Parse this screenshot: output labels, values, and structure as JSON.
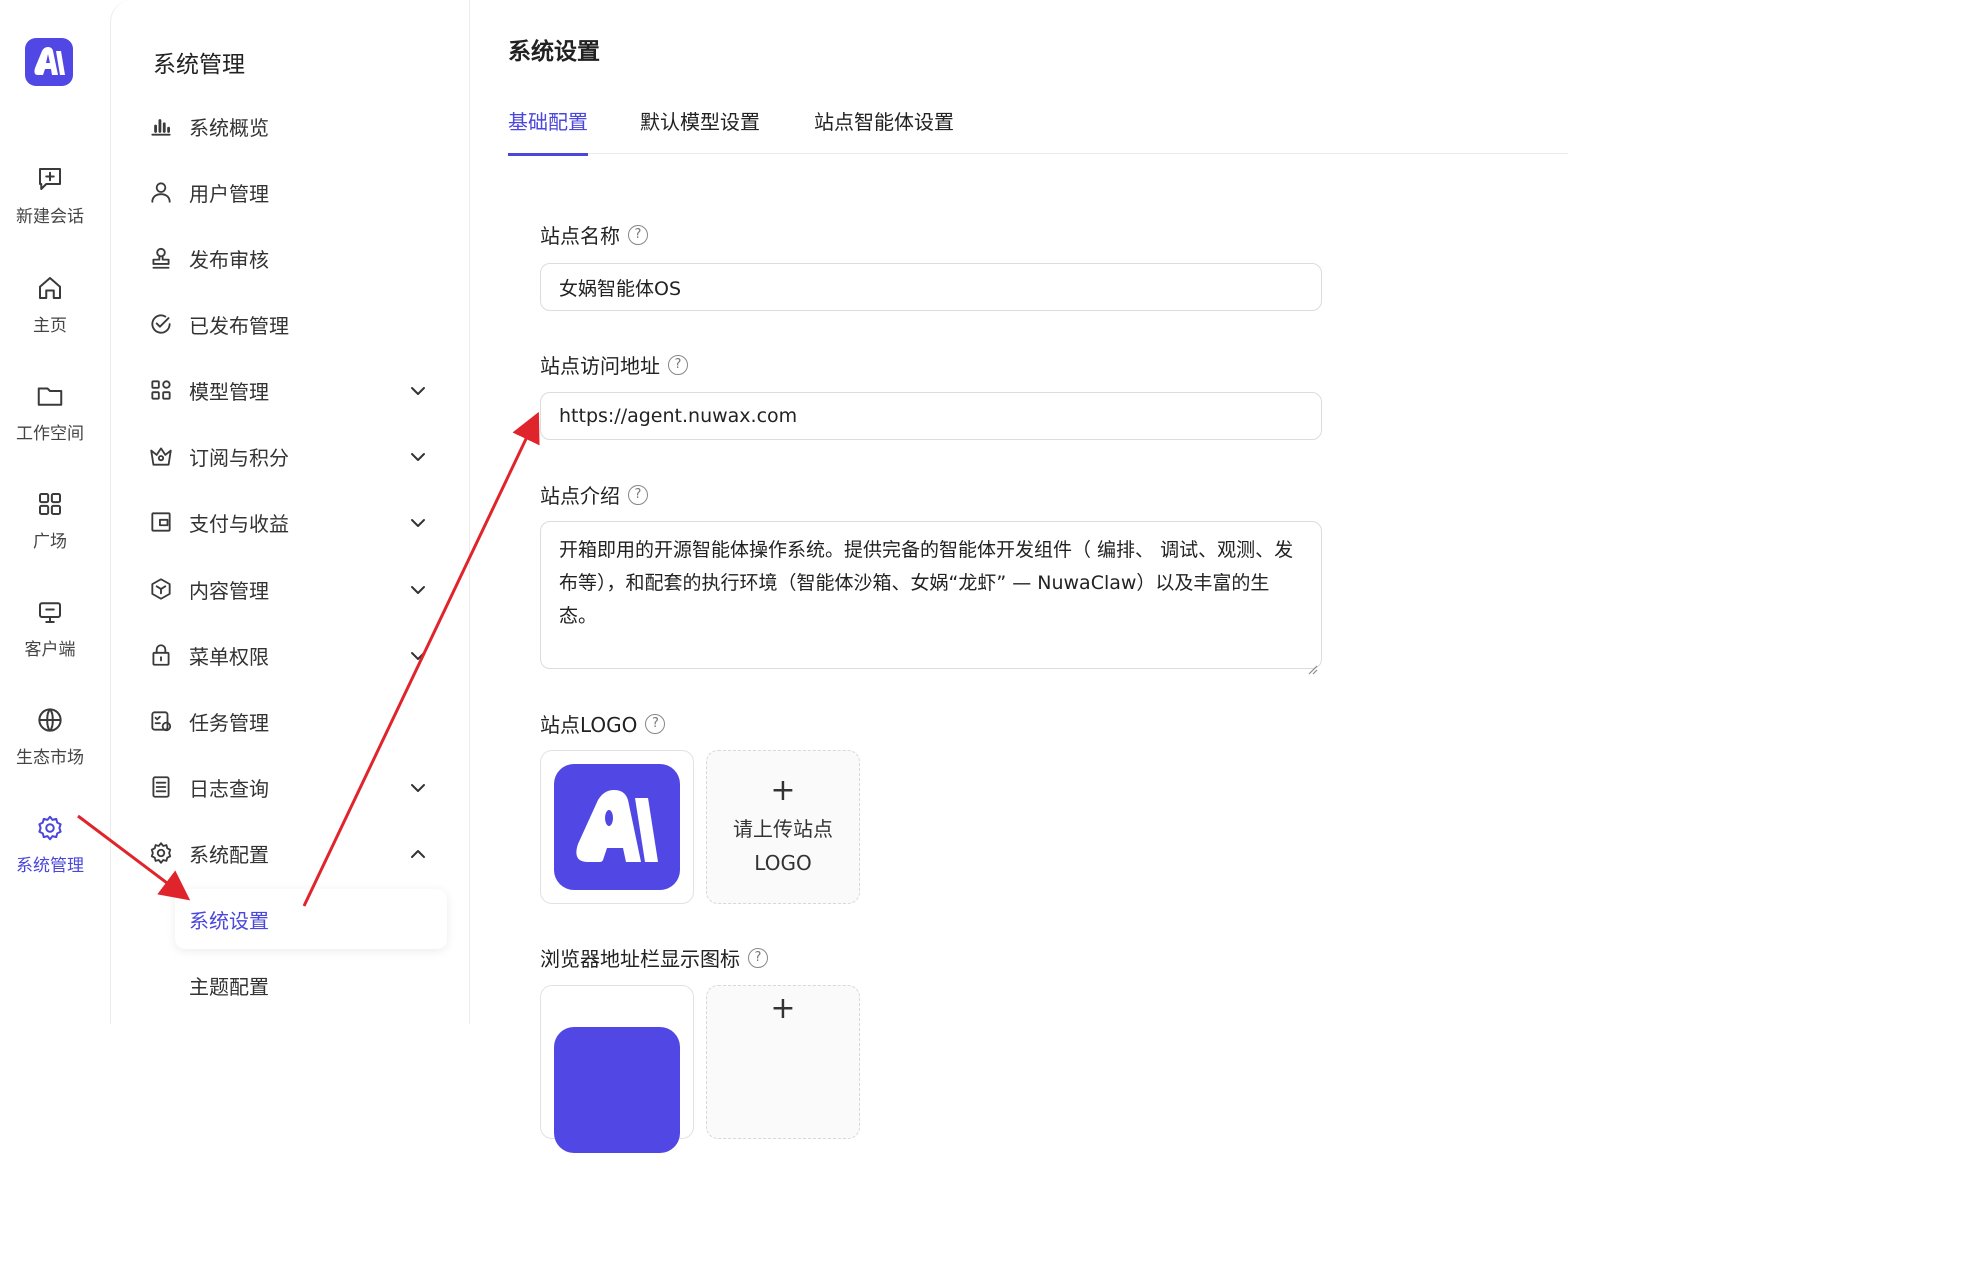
{
  "rail": {
    "items": [
      {
        "label": "新建会话",
        "icon": "chat-plus-icon"
      },
      {
        "label": "主页",
        "icon": "home-icon"
      },
      {
        "label": "工作空间",
        "icon": "folder-icon"
      },
      {
        "label": "广场",
        "icon": "grid-icon"
      },
      {
        "label": "客户端",
        "icon": "monitor-icon"
      },
      {
        "label": "生态市场",
        "icon": "globe-icon"
      },
      {
        "label": "系统管理",
        "icon": "gear-icon"
      }
    ],
    "active_color": "#4b46dc",
    "brand_color": "#5147e5"
  },
  "sidebar": {
    "title": "系统管理",
    "items": [
      {
        "label": "系统概览",
        "icon": "bar-chart-icon"
      },
      {
        "label": "用户管理",
        "icon": "user-icon"
      },
      {
        "label": "发布审核",
        "icon": "stamp-icon"
      },
      {
        "label": "已发布管理",
        "icon": "check-circle-icon"
      },
      {
        "label": "模型管理",
        "icon": "apps-icon",
        "expanded": false
      },
      {
        "label": "订阅与积分",
        "icon": "crown-icon",
        "expanded": false
      },
      {
        "label": "支付与收益",
        "icon": "wallet-icon",
        "expanded": false
      },
      {
        "label": "内容管理",
        "icon": "box-icon",
        "expanded": false
      },
      {
        "label": "菜单权限",
        "icon": "lock-icon",
        "expanded": false
      },
      {
        "label": "任务管理",
        "icon": "task-icon"
      },
      {
        "label": "日志查询",
        "icon": "log-icon",
        "expanded": false
      },
      {
        "label": "系统配置",
        "icon": "settings-icon",
        "expanded": true
      }
    ],
    "sub_items": [
      {
        "label": "系统设置",
        "active": true
      },
      {
        "label": "主题配置",
        "active": false
      }
    ]
  },
  "main": {
    "title": "系统设置",
    "tabs": [
      {
        "label": "基础配置",
        "active": true
      },
      {
        "label": "默认模型设置",
        "active": false
      },
      {
        "label": "站点智能体设置",
        "active": false
      }
    ],
    "fields": {
      "site_name": {
        "label": "站点名称",
        "value": "女娲智能体OS"
      },
      "site_url": {
        "label": "站点访问地址",
        "value": "https://agent.nuwax.com"
      },
      "site_intro": {
        "label": "站点介绍",
        "value": "开箱即用的开源智能体操作系统。提供完备的智能体开发组件（ 编排、 调试、观测、发布等），和配套的执行环境（智能体沙箱、女娲“龙虾” — NuwaClaw）以及丰富的生态。"
      },
      "site_logo": {
        "label": "站点LOGO",
        "upload_text": "请上传站点LOGO",
        "plus": "+"
      },
      "favicon": {
        "label": "浏览器地址栏显示图标",
        "plus": "+"
      }
    },
    "help_glyph": "?"
  },
  "annotation_color": "#e0242b"
}
